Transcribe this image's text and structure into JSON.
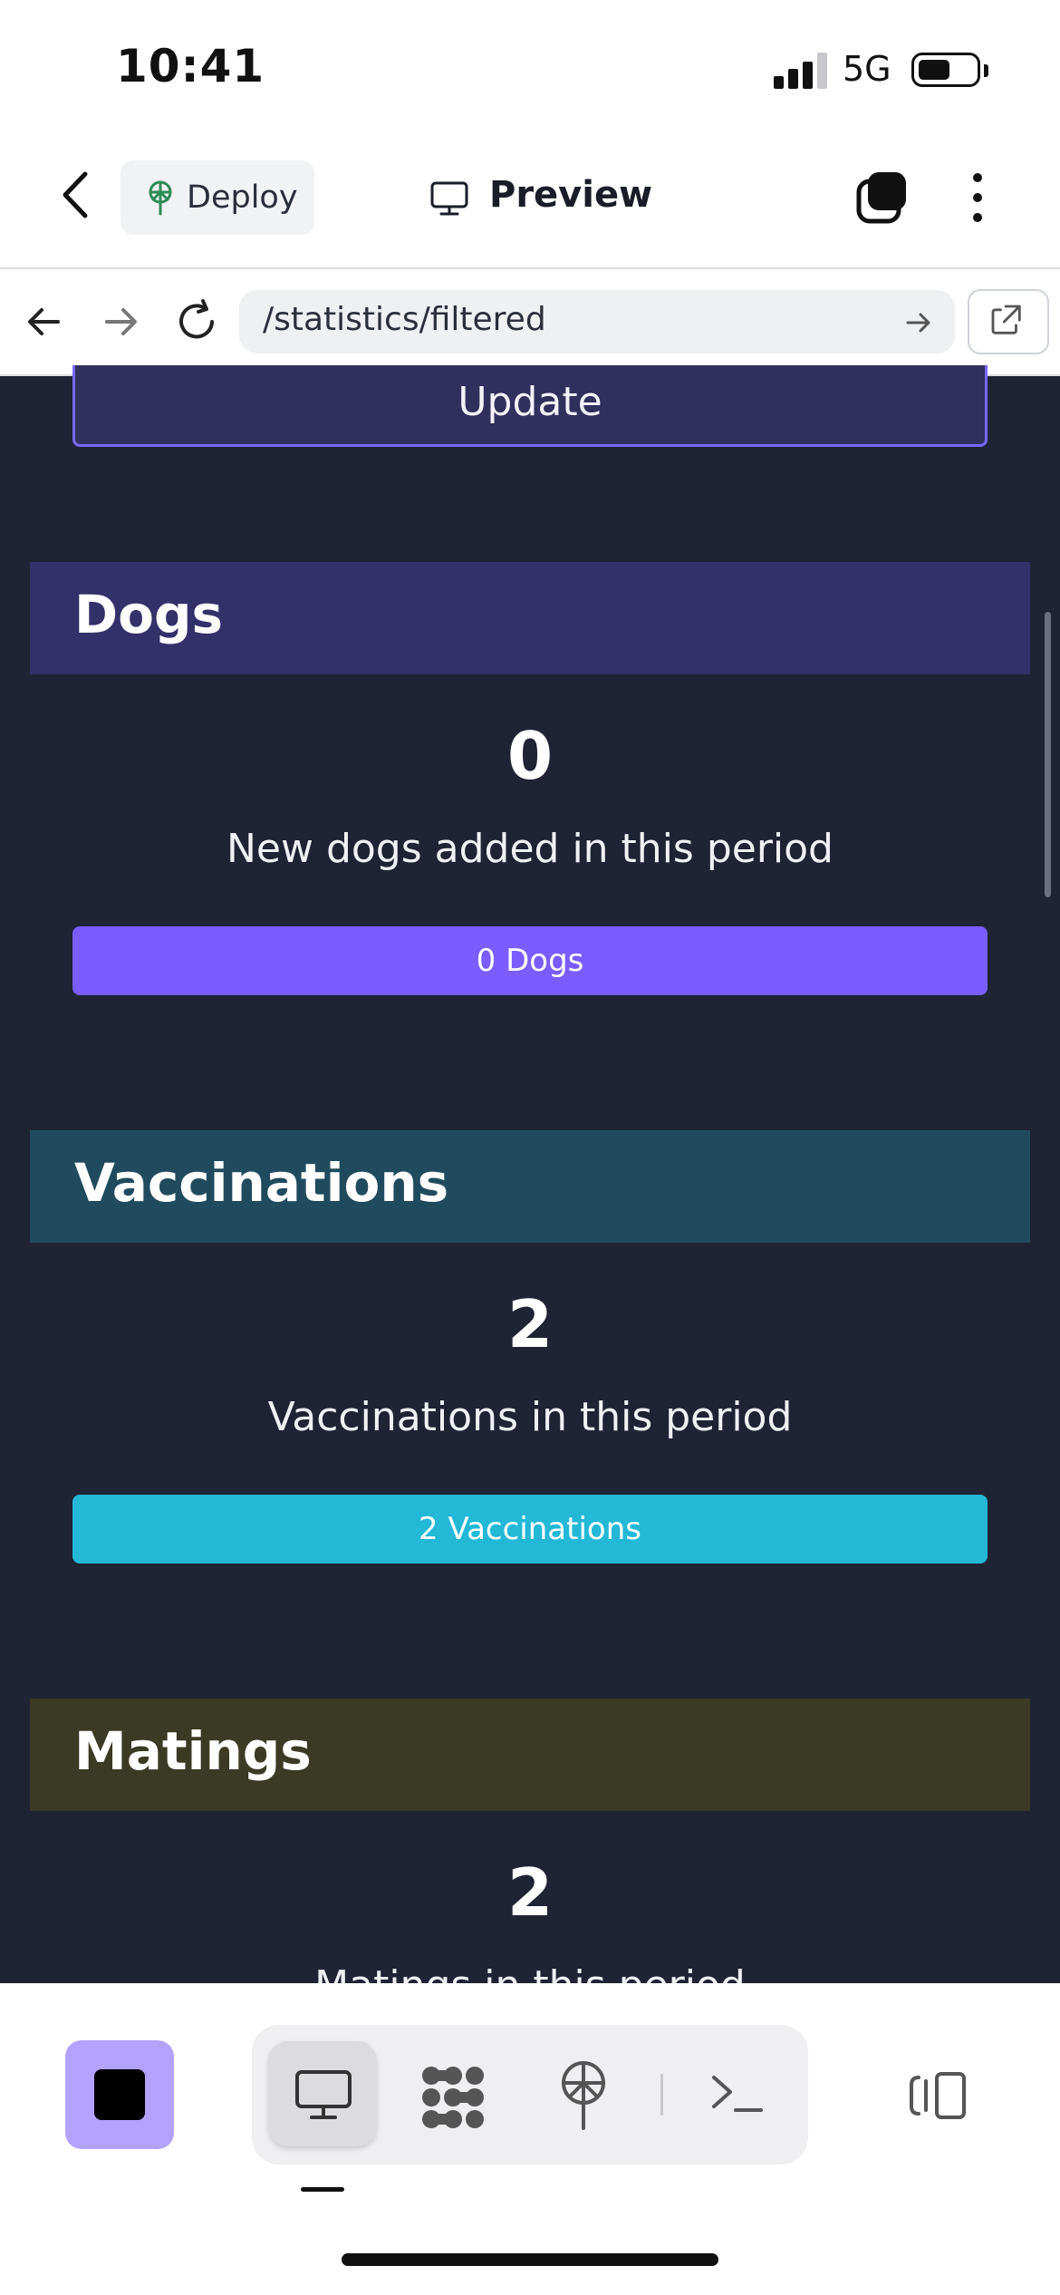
{
  "status_bar": {
    "time": "10:41",
    "network": "5G"
  },
  "header": {
    "deploy_label": "Deploy",
    "preview_label": "Preview",
    "icons": [
      "back-chevron-icon",
      "deploy-icon",
      "monitor-icon",
      "tabs-icon",
      "more-vertical-icon"
    ]
  },
  "browser": {
    "url": "/statistics/filtered",
    "icons": [
      "arrow-left-icon",
      "arrow-right-icon",
      "reload-icon",
      "arrow-go-icon",
      "external-link-icon"
    ]
  },
  "update_button": {
    "label": "Update"
  },
  "sections": [
    {
      "title": "Dogs",
      "count": "0",
      "description": "New dogs added in this period",
      "bar_label": "0 Dogs",
      "header_color": "#34306a",
      "bar_color": "#7a5cff"
    },
    {
      "title": "Vaccinations",
      "count": "2",
      "description": "Vaccinations in this period",
      "bar_label": "2 Vaccinations",
      "header_color": "#204b5e",
      "bar_color": "#22b8d6"
    },
    {
      "title": "Matings",
      "count": "2",
      "description": "Matings in this period",
      "bar_label": "",
      "header_color": "#3b3a24",
      "bar_color": ""
    }
  ],
  "bottom_bar": {
    "stop_button_color": "#b3a2ff",
    "tools": [
      "monitor-icon",
      "cluster-icon",
      "deploy-icon",
      "terminal-icon"
    ],
    "active_tool": "monitor-icon"
  },
  "colors": {
    "page_background": "#1f2334",
    "accent": "#7a67ff"
  }
}
